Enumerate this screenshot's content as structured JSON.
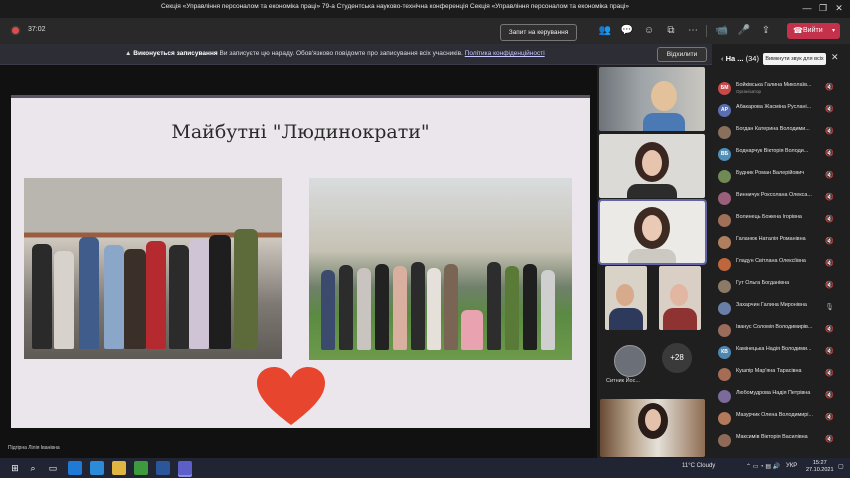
{
  "window": {
    "title": "Секція «Управління персоналом та економіка праці» 79-а Студентська науково-технічна конференція Секція «Управління персоналом та економіка праці»",
    "minimize": "—",
    "maximize": "❐",
    "close": "✕"
  },
  "meeting": {
    "timer": "37:02",
    "request_control": "Запит на керування",
    "leave_label": "Вийти",
    "leave_color": "#c4314b",
    "recording_color": "#e04b4b"
  },
  "banner": {
    "bold": "Виконується записування",
    "text": "Ви записуєте цю нараду. Обов'язково повідомте про записування всіх учасників.",
    "link": "Політика конфіденційності",
    "dismiss": "Відхилити"
  },
  "slide": {
    "title": "Майбутні \"Людинократи\"",
    "heart_color": "#e8452f",
    "presenter": "Підгірна Лілія Іванівна"
  },
  "tiles": {
    "avatar_name": "Ситник Йос...",
    "more_count": "+28"
  },
  "panel": {
    "heading_short": "На ...",
    "count": "(34)",
    "tooltip": "Вимкнути звук для всіх",
    "participants": [
      {
        "initials": "БМ",
        "name": "Бойківська Галина Миколаїв...",
        "role": "Організатор",
        "color": "#c74a4a"
      },
      {
        "initials": "АР",
        "name": "Абакарова Жасміна Руслані...",
        "role": "",
        "color": "#5b6fb0"
      },
      {
        "initials": "",
        "name": "Богдан Катерина Володими...",
        "role": "",
        "color": "#8a6f5d"
      },
      {
        "initials": "ВБ",
        "name": "Боднарчук Вікторія Володи...",
        "role": "",
        "color": "#4f8fb8"
      },
      {
        "initials": "",
        "name": "Будник Роман Валерійович",
        "role": "",
        "color": "#6f8a55"
      },
      {
        "initials": "",
        "name": "Винничук Роксолана Олекса...",
        "role": "",
        "color": "#9a5f7a"
      },
      {
        "initials": "",
        "name": "Волинець Божена Ігорівна",
        "role": "",
        "color": "#a07058"
      },
      {
        "initials": "",
        "name": "Галанюк Наталія Романівна",
        "role": "",
        "color": "#b0805e"
      },
      {
        "initials": "",
        "name": "Гладун Світлана Олексіївна",
        "role": "",
        "color": "#c0663c"
      },
      {
        "initials": "",
        "name": "Гут Ольга Богданівна",
        "role": "",
        "color": "#8d7a66"
      },
      {
        "initials": "",
        "name": "Захарчин Галина Миронівна",
        "role": "",
        "color": "#6a7fa8"
      },
      {
        "initials": "",
        "name": "Іванус Соломія Володимирів...",
        "role": "",
        "color": "#9b6b5b"
      },
      {
        "initials": "КВ",
        "name": "Камінецька Надія Володими...",
        "role": "",
        "color": "#4e86b0"
      },
      {
        "initials": "",
        "name": "Кушпір Мар'яна Тарасівна",
        "role": "",
        "color": "#a56d55"
      },
      {
        "initials": "",
        "name": "Любомудрова Надія Петрівна",
        "role": "",
        "color": "#7c6b9a"
      },
      {
        "initials": "",
        "name": "Мазурчик Олена Володимирі...",
        "role": "",
        "color": "#b27a5a"
      },
      {
        "initials": "",
        "name": "Максимів Вікторія Василівна",
        "role": "",
        "color": "#8f6a58"
      }
    ]
  },
  "taskbar": {
    "weather": "11°C  Cloudy",
    "lang": "УКР",
    "time": "15:27",
    "date": "27.10.2021"
  }
}
